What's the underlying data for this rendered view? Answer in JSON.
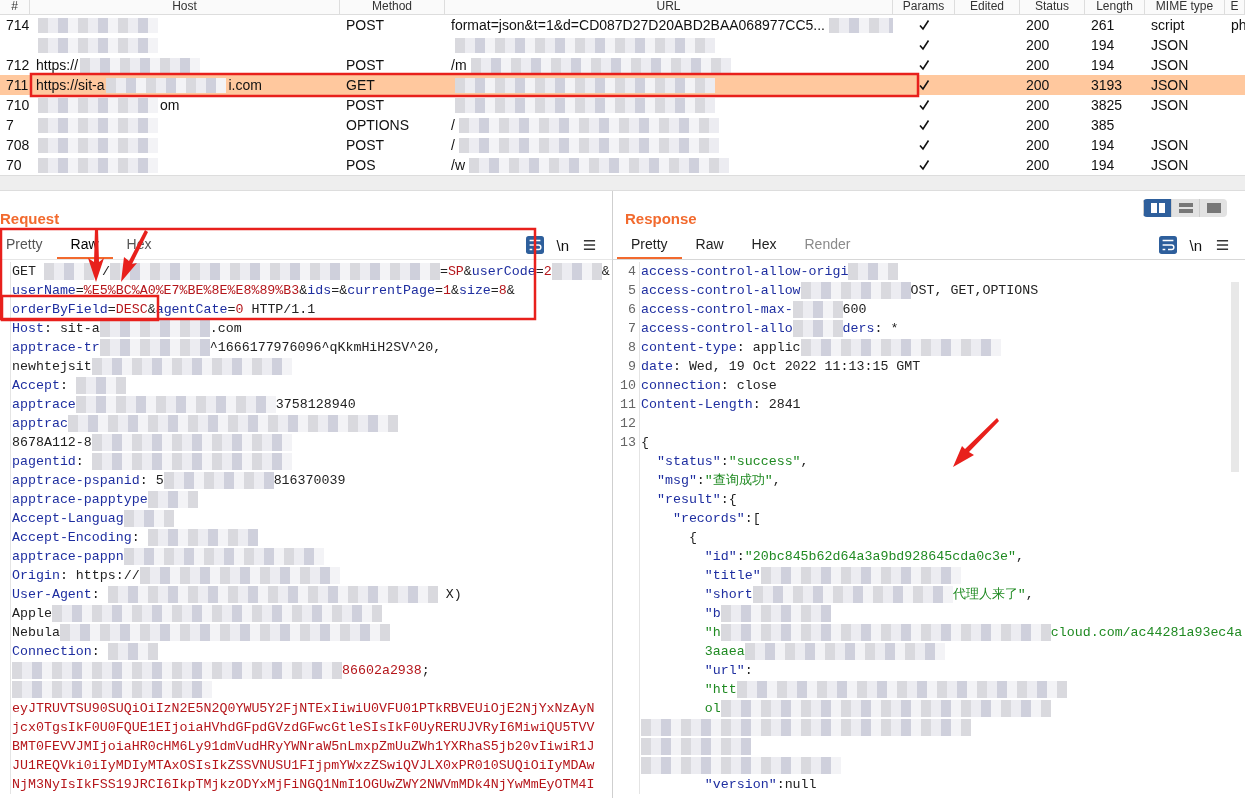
{
  "table": {
    "columns": [
      "#",
      "Host",
      "Method",
      "URL",
      "Params",
      "Edited",
      "Status",
      "Length",
      "MIME type",
      "E"
    ],
    "rows": [
      {
        "num": "714",
        "method": "POST",
        "url": "format=json&t=1&d=CD087D27D20ABD2BAA068977CC5...",
        "params": true,
        "status": "200",
        "length": "261",
        "mime": "script",
        "extension": "ph",
        "selected": false
      },
      {
        "params": true,
        "status": "200",
        "length": "194",
        "mime": "JSON",
        "selected": false
      },
      {
        "num": "712",
        "host": "https://",
        "method": "POST",
        "url": "/m",
        "params": true,
        "status": "200",
        "length": "194",
        "mime": "JSON",
        "selected": false
      },
      {
        "num": "711",
        "host": "https://sit-a",
        "host_end": "i.com",
        "method": "GET",
        "params": true,
        "status": "200",
        "length": "3193",
        "mime": "JSON",
        "selected": true
      },
      {
        "num": "710",
        "host_end": "om",
        "method": "POST",
        "params": true,
        "status": "200",
        "length": "3825",
        "mime": "JSON",
        "selected": false
      },
      {
        "num": "7",
        "method": "OPTIONS",
        "url": "/",
        "params": true,
        "status": "200",
        "length": "385",
        "selected": false
      },
      {
        "num": "708",
        "method": "POST",
        "url": "/",
        "params": true,
        "status": "200",
        "length": "194",
        "mime": "JSON",
        "selected": false
      },
      {
        "num": "70",
        "method": "POS",
        "url": "/w",
        "params": true,
        "status": "200",
        "length": "194",
        "mime": "JSON",
        "selected": false
      }
    ]
  },
  "request": {
    "title": "Request",
    "tabs": [
      {
        "label": "Pretty",
        "selected": false
      },
      {
        "label": "Raw",
        "selected": true
      },
      {
        "label": "Hex",
        "selected": false
      }
    ],
    "wrap_on": true,
    "newline_toggle": "\\n",
    "lines": [
      {
        "segments": [
          {
            "kind": "plain",
            "text": "GET "
          },
          {
            "kind": "blurshort"
          },
          {
            "kind": "plain",
            "text": " /"
          },
          {
            "kind": "blurwide"
          },
          {
            "kind": "plain",
            "text": "="
          },
          {
            "kind": "value",
            "text": "SP"
          },
          {
            "kind": "plain",
            "text": "&"
          },
          {
            "kind": "key",
            "text": "userCode"
          },
          {
            "kind": "plain",
            "text": "="
          },
          {
            "kind": "value",
            "text": "2"
          },
          {
            "kind": "blurshort"
          },
          {
            "kind": "plain",
            "text": "&"
          }
        ]
      },
      {
        "segments": [
          {
            "kind": "key",
            "text": "userName"
          },
          {
            "kind": "plain",
            "text": "="
          },
          {
            "kind": "value",
            "text": "%E5%BC%A0%E7%BE%8E%E8%89%B3"
          },
          {
            "kind": "plain",
            "text": "&"
          },
          {
            "kind": "key",
            "text": "ids"
          },
          {
            "kind": "plain",
            "text": "=&"
          },
          {
            "kind": "key",
            "text": "currentPage"
          },
          {
            "kind": "plain",
            "text": "="
          },
          {
            "kind": "value",
            "text": "1"
          },
          {
            "kind": "plain",
            "text": "&"
          },
          {
            "kind": "key",
            "text": "size"
          },
          {
            "kind": "plain",
            "text": "="
          },
          {
            "kind": "value",
            "text": "8"
          },
          {
            "kind": "plain",
            "text": "&"
          }
        ]
      },
      {
        "segments": [
          {
            "kind": "key",
            "text": "orderByField"
          },
          {
            "kind": "plain",
            "text": "="
          },
          {
            "kind": "value",
            "text": "DESC"
          },
          {
            "kind": "plain",
            "text": "&"
          },
          {
            "kind": "key",
            "text": "agentCate"
          },
          {
            "kind": "plain",
            "text": "="
          },
          {
            "kind": "value",
            "text": "0"
          },
          {
            "kind": "plain",
            "text": " HTTP/1.1"
          }
        ]
      },
      {
        "segments": [
          {
            "kind": "key",
            "text": "Host"
          },
          {
            "kind": "plain",
            "text": ": sit-a"
          },
          {
            "kind": "blurmedium"
          },
          {
            "kind": "plain",
            "text": ".com"
          }
        ]
      },
      {
        "segments": [
          {
            "kind": "key",
            "text": "apptrace-tr"
          },
          {
            "kind": "blurmedium"
          },
          {
            "kind": "plain",
            "text": "^1666177976096^qKkmHiH2SV^20,"
          }
        ]
      },
      {
        "segments": [
          {
            "kind": "plain",
            "text": "newhtejsit"
          },
          {
            "kind": "blurlong"
          }
        ]
      },
      {
        "segments": [
          {
            "kind": "key",
            "text": "Accept"
          },
          {
            "kind": "plain",
            "text": ": "
          },
          {
            "kind": "blurshort"
          }
        ]
      },
      {
        "segments": [
          {
            "kind": "key",
            "text": "apptrace"
          },
          {
            "kind": "blurlong"
          },
          {
            "kind": "plain",
            "text": "3758128940"
          }
        ]
      },
      {
        "segments": [
          {
            "kind": "key",
            "text": "apptrac"
          },
          {
            "kind": "blurwide"
          }
        ]
      },
      {
        "segments": [
          {
            "kind": "plain",
            "text": "8678A112-8"
          },
          {
            "kind": "blurlong"
          }
        ]
      },
      {
        "segments": [
          {
            "kind": "key",
            "text": "pagentid"
          },
          {
            "kind": "plain",
            "text": ": "
          },
          {
            "kind": "blurlong"
          }
        ]
      },
      {
        "segments": [
          {
            "kind": "key",
            "text": "apptrace-pspanid"
          },
          {
            "kind": "plain",
            "text": ": 5"
          },
          {
            "kind": "blurmedium"
          },
          {
            "kind": "plain",
            "text": "816370039"
          }
        ]
      },
      {
        "segments": [
          {
            "kind": "key",
            "text": "apptrace-papptype"
          },
          {
            "kind": "blurshort"
          }
        ]
      },
      {
        "segments": [
          {
            "kind": "key",
            "text": "Accept-Languag"
          },
          {
            "kind": "blurshort"
          }
        ]
      },
      {
        "segments": [
          {
            "kind": "key",
            "text": "Accept-Encoding"
          },
          {
            "kind": "plain",
            "text": ": "
          },
          {
            "kind": "blurmedium"
          }
        ]
      },
      {
        "segments": [
          {
            "kind": "key",
            "text": "apptrace-pappn"
          },
          {
            "kind": "blurlong"
          }
        ]
      },
      {
        "segments": [
          {
            "kind": "key",
            "text": "Origin"
          },
          {
            "kind": "plain",
            "text": ": https://"
          },
          {
            "kind": "blurlong"
          }
        ]
      },
      {
        "segments": [
          {
            "kind": "key",
            "text": "User-Agent"
          },
          {
            "kind": "plain",
            "text": ": "
          },
          {
            "kind": "blurwide"
          },
          {
            "kind": "plain",
            "text": " X)"
          }
        ]
      },
      {
        "segments": [
          {
            "kind": "plain",
            "text": "Apple"
          },
          {
            "kind": "blurwide"
          }
        ]
      },
      {
        "segments": [
          {
            "kind": "plain",
            "text": "Nebula"
          },
          {
            "kind": "blurwide"
          }
        ]
      },
      {
        "segments": [
          {
            "kind": "key",
            "text": "Connection"
          },
          {
            "kind": "plain",
            "text": ": "
          },
          {
            "kind": "blurshort"
          }
        ]
      },
      {
        "segments": [
          {
            "kind": "blurwide"
          },
          {
            "kind": "value",
            "text": "86602a2938"
          },
          {
            "kind": "plain",
            "text": ";"
          }
        ]
      },
      {
        "segments": [
          {
            "kind": "blurlong"
          }
        ]
      },
      {
        "segments": [
          {
            "kind": "value",
            "text": "eyJTRUVTSU90SUQiOiIzN2E5N2Q0YWU5Y2FjNTExIiwiU0VFU01PTkRBVEUiOjE2NjYxNzAyN"
          }
        ]
      },
      {
        "segments": [
          {
            "kind": "value",
            "text": "jcx0TgsIkF0U0FQUE1EIjoiaHVhdGFpdGVzdGFwcGtleSIsIkF0UyRERUJVRyI6MiwiQU5TVV"
          }
        ]
      },
      {
        "segments": [
          {
            "kind": "value",
            "text": "BMT0FEVVJMIjoiaHR0cHM6Ly91dmVudHRyYWNraW5nLmxpZmUuZWh1YXRhaS5jb20vIiwiR1J"
          }
        ]
      },
      {
        "segments": [
          {
            "kind": "value",
            "text": "JU1REQVki0iIyMDIyMTAxOSIsIkZSSVNUSU1FIjpmYWxzZSwiQVJLX0xPR010SUQiOiIyMDAw"
          }
        ]
      },
      {
        "segments": [
          {
            "kind": "value",
            "text": "NjM3NyIsIkFSS19JRCI6IkpTMjkzODYxMjFiNGQ1NmI1OGUwZWY2NWVmMDk4NjYwMmEyOTM4I"
          }
        ]
      }
    ]
  },
  "response": {
    "title": "Response",
    "tabs": [
      {
        "label": "Pretty",
        "selected": true,
        "disabled": false
      },
      {
        "label": "Raw",
        "selected": false,
        "disabled": false
      },
      {
        "label": "Hex",
        "selected": false,
        "disabled": false
      },
      {
        "label": "Render",
        "selected": false,
        "disabled": true
      }
    ],
    "layout_modes": [
      {
        "kind": "columns",
        "selected": true
      },
      {
        "kind": "rows",
        "selected": false
      },
      {
        "kind": "single",
        "selected": false
      }
    ],
    "wrap_on": true,
    "newline_toggle": "\\n",
    "lines": [
      {
        "num": "4",
        "segments": [
          {
            "kind": "key",
            "text": "access-control-allow-origi"
          },
          {
            "kind": "blurshort"
          }
        ]
      },
      {
        "num": "5",
        "segments": [
          {
            "kind": "key",
            "text": "access-control-allow"
          },
          {
            "kind": "blurmedium"
          },
          {
            "kind": "plain",
            "text": "OST, GET,OPTIONS"
          }
        ]
      },
      {
        "num": "6",
        "segments": [
          {
            "kind": "key",
            "text": "access-control-max-"
          },
          {
            "kind": "blurshort"
          },
          {
            "kind": "plain",
            "text": "600"
          }
        ]
      },
      {
        "num": "7",
        "segments": [
          {
            "kind": "key",
            "text": "access-control-allo"
          },
          {
            "kind": "blurshort"
          },
          {
            "kind": "key",
            "text": "ders"
          },
          {
            "kind": "plain",
            "text": ": *"
          }
        ]
      },
      {
        "num": "8",
        "segments": [
          {
            "kind": "key",
            "text": "content-type"
          },
          {
            "kind": "plain",
            "text": ": applic"
          },
          {
            "kind": "blurlong"
          }
        ]
      },
      {
        "num": "9",
        "segments": [
          {
            "kind": "key",
            "text": "date"
          },
          {
            "kind": "plain",
            "text": ": Wed, 19 Oct 2022 11:13:15 GMT"
          }
        ]
      },
      {
        "num": "10",
        "segments": [
          {
            "kind": "key",
            "text": "connection"
          },
          {
            "kind": "plain",
            "text": ": close"
          }
        ]
      },
      {
        "num": "11",
        "segments": [
          {
            "kind": "key",
            "text": "Content-Length"
          },
          {
            "kind": "plain",
            "text": ": 2841"
          }
        ]
      },
      {
        "num": "12"
      },
      {
        "num": "13",
        "segments": [
          {
            "kind": "plain",
            "text": "{"
          }
        ]
      },
      {
        "segments": [
          {
            "kind": "key",
            "text": "  \"status\""
          },
          {
            "kind": "plain",
            "text": ":"
          },
          {
            "kind": "string",
            "text": "\"success\""
          },
          {
            "kind": "plain",
            "text": ","
          }
        ]
      },
      {
        "segments": [
          {
            "kind": "key",
            "text": "  \"msg\""
          },
          {
            "kind": "plain",
            "text": ":"
          },
          {
            "kind": "string",
            "text": "\"查询成功\""
          },
          {
            "kind": "plain",
            "text": ","
          }
        ]
      },
      {
        "segments": [
          {
            "kind": "key",
            "text": "  \"result\""
          },
          {
            "kind": "plain",
            "text": ":{"
          }
        ]
      },
      {
        "segments": [
          {
            "kind": "key",
            "text": "    \"records\""
          },
          {
            "kind": "plain",
            "text": ":["
          }
        ]
      },
      {
        "segments": [
          {
            "kind": "plain",
            "text": "      {"
          }
        ]
      },
      {
        "segments": [
          {
            "kind": "key",
            "text": "        \"id\""
          },
          {
            "kind": "plain",
            "text": ":"
          },
          {
            "kind": "string",
            "text": "\"20bc845b62d64a3a9bd928645cda0c3e\""
          },
          {
            "kind": "plain",
            "text": ","
          }
        ]
      },
      {
        "segments": [
          {
            "kind": "key",
            "text": "        \"title\""
          },
          {
            "kind": "blurlong"
          }
        ]
      },
      {
        "segments": [
          {
            "kind": "key",
            "text": "        \"short"
          },
          {
            "kind": "blurlong"
          },
          {
            "kind": "string",
            "text": "代理人来了\""
          },
          {
            "kind": "plain",
            "text": ","
          }
        ]
      },
      {
        "segments": [
          {
            "kind": "key",
            "text": "        \"b"
          },
          {
            "kind": "blurmedium"
          }
        ]
      },
      {
        "segments": [
          {
            "kind": "string",
            "text": "        \"h"
          },
          {
            "kind": "blurwide"
          },
          {
            "kind": "string",
            "text": "cloud.com/ac44281a93ec4a"
          }
        ]
      },
      {
        "segments": [
          {
            "kind": "string",
            "text": "        3aaea"
          },
          {
            "kind": "blurlong"
          }
        ]
      },
      {
        "segments": [
          {
            "kind": "key",
            "text": "        \"url\""
          },
          {
            "kind": "plain",
            "text": ":"
          }
        ]
      },
      {
        "segments": [
          {
            "kind": "string",
            "text": "        \"htt"
          },
          {
            "kind": "blurwide"
          }
        ]
      },
      {
        "segments": [
          {
            "kind": "string",
            "text": "        ol"
          },
          {
            "kind": "blurwide"
          }
        ]
      },
      {
        "segments": [
          {
            "kind": "blurwide"
          }
        ]
      },
      {
        "segments": [
          {
            "kind": "blurmedium"
          }
        ]
      },
      {
        "segments": [
          {
            "kind": "blurlong"
          }
        ]
      },
      {
        "segments": [
          {
            "kind": "key",
            "text": "        \"version\""
          },
          {
            "kind": "plain",
            "text": ":null"
          }
        ]
      }
    ]
  }
}
